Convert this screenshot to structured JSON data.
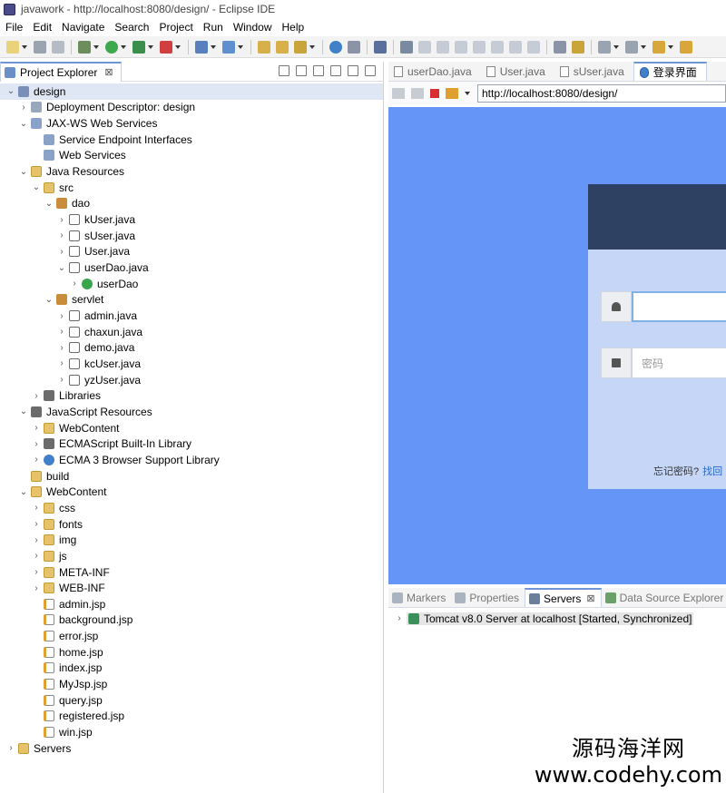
{
  "window": {
    "title": "javawork - http://localhost:8080/design/ - Eclipse IDE"
  },
  "menu": [
    "File",
    "Edit",
    "Navigate",
    "Search",
    "Project",
    "Run",
    "Window",
    "Help"
  ],
  "explorer": {
    "tab_label": "Project Explorer",
    "tab_close": "⊠",
    "tree": [
      {
        "label": "design",
        "depth": 0,
        "twisty": "v",
        "icon": "project-icon",
        "selected": true
      },
      {
        "label": "Deployment Descriptor: design",
        "depth": 1,
        "twisty": ">",
        "icon": "deployment-descriptor-icon"
      },
      {
        "label": "JAX-WS Web Services",
        "depth": 1,
        "twisty": "v",
        "icon": "web-services-icon"
      },
      {
        "label": "Service Endpoint Interfaces",
        "depth": 2,
        "twisty": "",
        "icon": "interface-icon"
      },
      {
        "label": "Web Services",
        "depth": 2,
        "twisty": "",
        "icon": "web-services-icon"
      },
      {
        "label": "Java Resources",
        "depth": 1,
        "twisty": "v",
        "icon": "java-resources-icon"
      },
      {
        "label": "src",
        "depth": 2,
        "twisty": "v",
        "icon": "source-folder-icon"
      },
      {
        "label": "dao",
        "depth": 3,
        "twisty": "v",
        "icon": "package-icon"
      },
      {
        "label": "kUser.java",
        "depth": 4,
        "twisty": ">",
        "icon": "java-file-icon"
      },
      {
        "label": "sUser.java",
        "depth": 4,
        "twisty": ">",
        "icon": "java-file-icon"
      },
      {
        "label": "User.java",
        "depth": 4,
        "twisty": ">",
        "icon": "java-file-icon"
      },
      {
        "label": "userDao.java",
        "depth": 4,
        "twisty": "v",
        "icon": "java-file-icon"
      },
      {
        "label": "userDao",
        "depth": 5,
        "twisty": ">",
        "icon": "class-icon"
      },
      {
        "label": "servlet",
        "depth": 3,
        "twisty": "v",
        "icon": "package-icon"
      },
      {
        "label": "admin.java",
        "depth": 4,
        "twisty": ">",
        "icon": "java-file-icon"
      },
      {
        "label": "chaxun.java",
        "depth": 4,
        "twisty": ">",
        "icon": "java-file-icon"
      },
      {
        "label": "demo.java",
        "depth": 4,
        "twisty": ">",
        "icon": "java-file-icon"
      },
      {
        "label": "kcUser.java",
        "depth": 4,
        "twisty": ">",
        "icon": "java-file-icon"
      },
      {
        "label": "yzUser.java",
        "depth": 4,
        "twisty": ">",
        "icon": "java-file-icon"
      },
      {
        "label": "Libraries",
        "depth": 2,
        "twisty": ">",
        "icon": "library-icon"
      },
      {
        "label": "JavaScript Resources",
        "depth": 1,
        "twisty": "v",
        "icon": "library-icon"
      },
      {
        "label": "WebContent",
        "depth": 2,
        "twisty": ">",
        "icon": "web-content-icon"
      },
      {
        "label": "ECMAScript Built-In Library",
        "depth": 2,
        "twisty": ">",
        "icon": "library-icon"
      },
      {
        "label": "ECMA 3 Browser Support Library",
        "depth": 2,
        "twisty": ">",
        "icon": "globe-icon"
      },
      {
        "label": "build",
        "depth": 1,
        "twisty": "",
        "icon": "folder-icon"
      },
      {
        "label": "WebContent",
        "depth": 1,
        "twisty": "v",
        "icon": "folder-icon"
      },
      {
        "label": "css",
        "depth": 2,
        "twisty": ">",
        "icon": "folder-icon"
      },
      {
        "label": "fonts",
        "depth": 2,
        "twisty": ">",
        "icon": "folder-icon"
      },
      {
        "label": "img",
        "depth": 2,
        "twisty": ">",
        "icon": "folder-icon"
      },
      {
        "label": "js",
        "depth": 2,
        "twisty": ">",
        "icon": "folder-icon"
      },
      {
        "label": "META-INF",
        "depth": 2,
        "twisty": ">",
        "icon": "folder-icon"
      },
      {
        "label": "WEB-INF",
        "depth": 2,
        "twisty": ">",
        "icon": "folder-icon"
      },
      {
        "label": "admin.jsp",
        "depth": 2,
        "twisty": "",
        "icon": "jsp-file-icon"
      },
      {
        "label": "background.jsp",
        "depth": 2,
        "twisty": "",
        "icon": "jsp-file-icon"
      },
      {
        "label": "error.jsp",
        "depth": 2,
        "twisty": "",
        "icon": "jsp-file-icon"
      },
      {
        "label": "home.jsp",
        "depth": 2,
        "twisty": "",
        "icon": "jsp-file-icon"
      },
      {
        "label": "index.jsp",
        "depth": 2,
        "twisty": "",
        "icon": "jsp-file-icon"
      },
      {
        "label": "MyJsp.jsp",
        "depth": 2,
        "twisty": "",
        "icon": "jsp-file-icon"
      },
      {
        "label": "query.jsp",
        "depth": 2,
        "twisty": "",
        "icon": "jsp-file-icon"
      },
      {
        "label": "registered.jsp",
        "depth": 2,
        "twisty": "",
        "icon": "jsp-file-icon"
      },
      {
        "label": "win.jsp",
        "depth": 2,
        "twisty": "",
        "icon": "jsp-file-icon"
      },
      {
        "label": "Servers",
        "depth": 0,
        "twisty": ">",
        "icon": "folder-icon"
      }
    ]
  },
  "editor": {
    "tabs": [
      {
        "label": "userDao.java",
        "active": false
      },
      {
        "label": "User.java",
        "active": false
      },
      {
        "label": "sUser.java",
        "active": false
      },
      {
        "label": "登录界面",
        "active": true
      }
    ],
    "url": "http://localhost:8080/design/",
    "login": {
      "password_placeholder": "密码",
      "forgot_text": "忘记密码?",
      "forgot_link": "找回",
      "page_bg": "#6495f7",
      "header_bg": "#2f4163",
      "card_bg": "#c5d6f7"
    }
  },
  "panel": {
    "tabs": [
      {
        "label": "Markers",
        "active": false
      },
      {
        "label": "Properties",
        "active": false
      },
      {
        "label": "Servers",
        "active": true
      },
      {
        "label": "Data Source Explorer",
        "active": false
      }
    ],
    "server": "Tomcat v8.0 Server at localhost  [Started, Synchronized]"
  },
  "watermark": {
    "line1": "源码海洋网",
    "line2": "www.codehy.com"
  }
}
